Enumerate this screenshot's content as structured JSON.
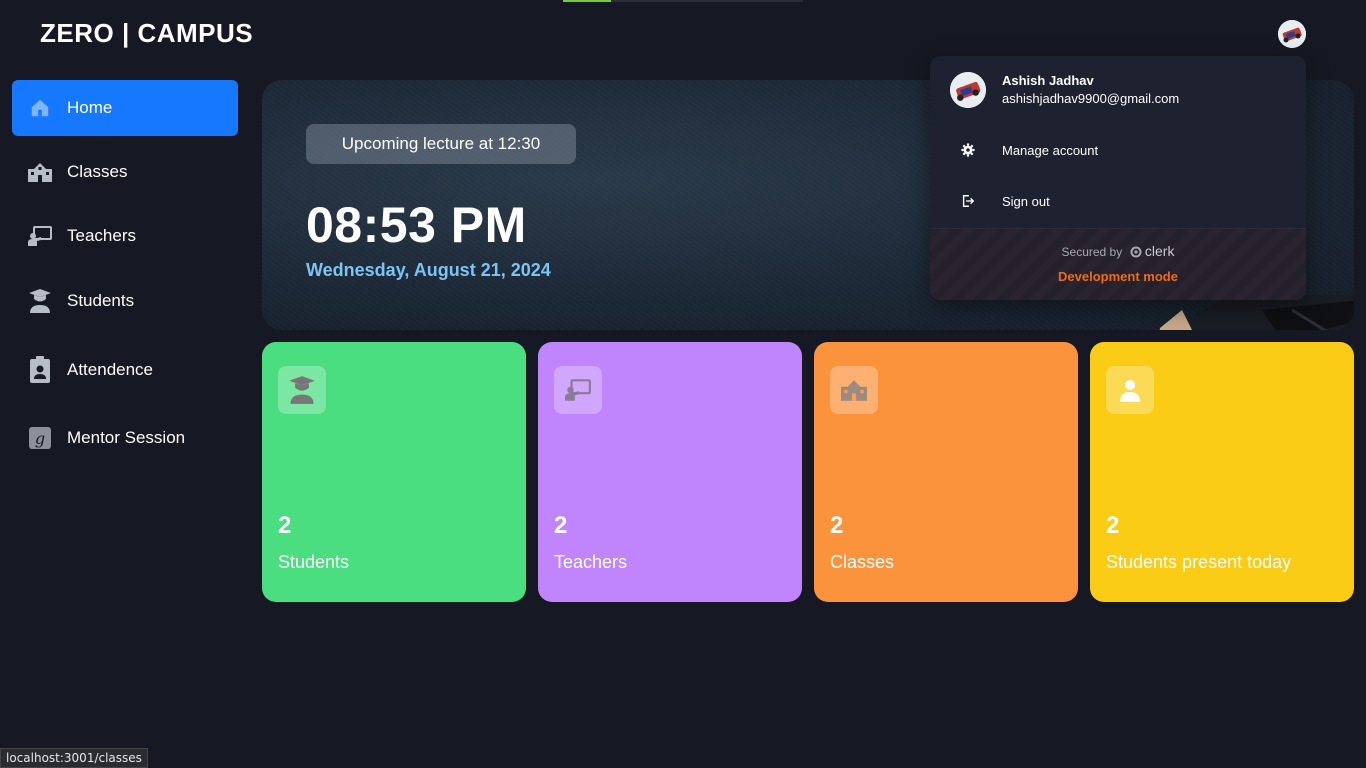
{
  "app": {
    "logo": "ZERO | CAMPUS"
  },
  "page_load_progress": 0.2,
  "sidebar": {
    "items": [
      {
        "label": "Home",
        "icon": "home-icon",
        "active": true
      },
      {
        "label": "Classes",
        "icon": "school-building-icon",
        "active": false
      },
      {
        "label": "Teachers",
        "icon": "teacher-board-icon",
        "active": false
      },
      {
        "label": "Students",
        "icon": "graduate-icon",
        "active": false
      },
      {
        "label": "Attendence",
        "icon": "clipboard-user-icon",
        "active": false
      },
      {
        "label": "Mentor Session",
        "icon": "mentor-g-icon",
        "active": false
      }
    ]
  },
  "hero": {
    "lecture": "Upcoming lecture at 12:30",
    "time": "08:53 PM",
    "date": "Wednesday, August 21, 2024"
  },
  "stats": [
    {
      "count": "2",
      "label": "Students",
      "color": "#4ade80",
      "icon": "graduate-icon"
    },
    {
      "count": "2",
      "label": "Teachers",
      "color": "#c084fc",
      "icon": "teacher-board-icon"
    },
    {
      "count": "2",
      "label": "Classes",
      "color": "#fb923c",
      "icon": "school-building-icon"
    },
    {
      "count": "2",
      "label": "Students present today",
      "color": "#facc15",
      "icon": "user-icon"
    }
  ],
  "account_menu": {
    "name": "Ashish Jadhav",
    "email": "ashishjadhav9900@gmail.com",
    "manage": "Manage account",
    "signout": "Sign out",
    "secured_by": "Secured by",
    "provider": "clerk",
    "dev_mode": "Development mode"
  },
  "statusbar": {
    "url": "localhost:3001/classes"
  },
  "colors": {
    "accent": "#1677ff",
    "background": "#161823",
    "date": "#7cc4f4",
    "dev_mode": "#f06a1b"
  }
}
